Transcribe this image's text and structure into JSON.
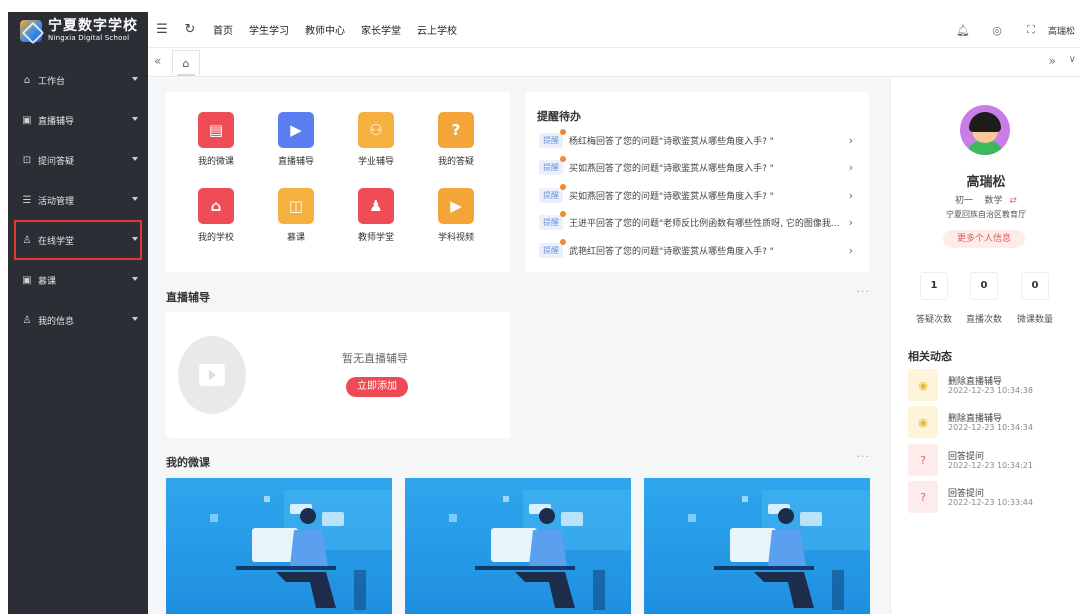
{
  "app": {
    "logo_title": "宁夏数字学校",
    "logo_subtitle": "Ningxia Digital School"
  },
  "sidebar": {
    "items": [
      {
        "label": "工作台",
        "icon": "home-icon"
      },
      {
        "label": "直播辅导",
        "icon": "play-icon"
      },
      {
        "label": "提问答疑",
        "icon": "question-icon"
      },
      {
        "label": "活动管理",
        "icon": "grid-icon"
      },
      {
        "label": "在线学堂",
        "icon": "user-icon",
        "highlighted": true
      },
      {
        "label": "慕课",
        "icon": "play-icon"
      },
      {
        "label": "我的信息",
        "icon": "person-icon"
      }
    ]
  },
  "topbar": {
    "nav": [
      "首页",
      "学生学习",
      "教师中心",
      "家长学堂",
      "云上学校"
    ],
    "user": "高瑞松"
  },
  "quick_links": [
    "我的微课",
    "直播辅导",
    "学业辅导",
    "我的答疑",
    "我的学校",
    "慕课",
    "教师学堂",
    "学科视频"
  ],
  "reminders": {
    "title": "提醒待办",
    "tag": "提醒",
    "items": [
      "杨红梅回答了您的问题\"诗歌鉴赏从哪些角度入手? \"",
      "买如燕回答了您的问题\"诗歌鉴赏从哪些角度入手? \"",
      "买如燕回答了您的问题\"诗歌鉴赏从哪些角度入手? \"",
      "王进平回答了您的问题\"老师反比例函数有哪些性质呀, 它的图像我...",
      "武艳红回答了您的问题\"诗歌鉴赏从哪些角度入手? \""
    ]
  },
  "live_section": {
    "title": "直播辅导",
    "more": "···",
    "empty_text": "暂无直播辅导",
    "add_button": "立即添加"
  },
  "microcourse_section": {
    "title": "我的微课",
    "more": "···"
  },
  "profile": {
    "name": "高瑞松",
    "grade": "初一",
    "subject": "数学",
    "org": "宁夏回族自治区教育厅",
    "more_button": "更多个人信息",
    "stats": [
      {
        "value": "1",
        "label": "答疑次数"
      },
      {
        "value": "0",
        "label": "直播次数"
      },
      {
        "value": "0",
        "label": "微课数量"
      }
    ]
  },
  "activity": {
    "title": "相关动态",
    "items": [
      {
        "title": "删除直播辅导",
        "time": "2022-12-23 10:34:38",
        "icon": "eye-icon"
      },
      {
        "title": "删除直播辅导",
        "time": "2022-12-23 10:34:34",
        "icon": "eye-icon"
      },
      {
        "title": "回答提问",
        "time": "2022-12-23 10:34:21",
        "icon": "question-circle-icon"
      },
      {
        "title": "回答提问",
        "time": "2022-12-23 10:33:44",
        "icon": "question-circle-icon"
      }
    ]
  },
  "colors": {
    "sidebar_bg": "#2b2e35",
    "accent_red": "#ee4a55",
    "highlight_border": "#e03a2e",
    "card_blue": "#1e8fdf"
  }
}
